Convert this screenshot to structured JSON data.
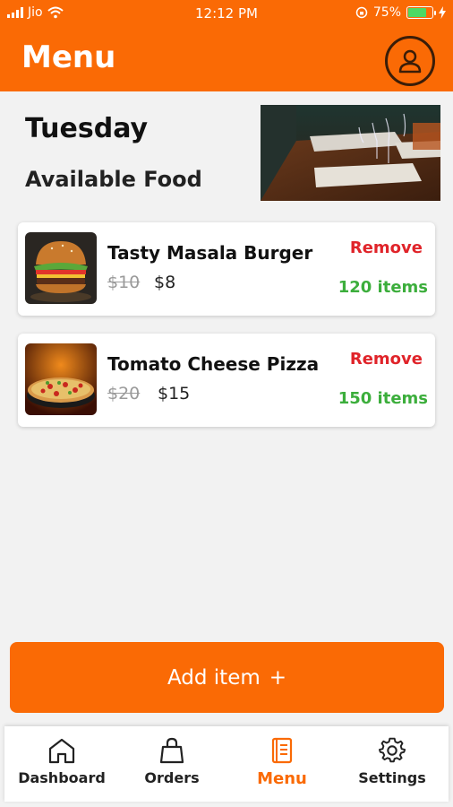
{
  "status_bar": {
    "carrier": "Jio",
    "time": "12:12 PM",
    "battery": "75%"
  },
  "header": {
    "title": "Menu"
  },
  "day": "Tuesday",
  "section_title": "Available Food",
  "items": [
    {
      "name": "Tasty Masala Burger",
      "old_price": "$10",
      "new_price": "$8",
      "remove_label": "Remove",
      "stock": "120 items"
    },
    {
      "name": "Tomato Cheese Pizza",
      "old_price": "$20",
      "new_price": "$15",
      "remove_label": "Remove",
      "stock": "150 items"
    }
  ],
  "add_button": {
    "label": "Add item",
    "icon": "+"
  },
  "tabs": [
    {
      "label": "Dashboard",
      "icon": "home-icon"
    },
    {
      "label": "Orders",
      "icon": "shopping-bag-icon"
    },
    {
      "label": "Menu",
      "icon": "menu-book-icon",
      "active": true
    },
    {
      "label": "Settings",
      "icon": "gear-icon"
    }
  ],
  "colors": {
    "brand": "#fa6a05",
    "remove": "#e0242a",
    "stock": "#3cae3c",
    "battery": "#4cd964"
  }
}
